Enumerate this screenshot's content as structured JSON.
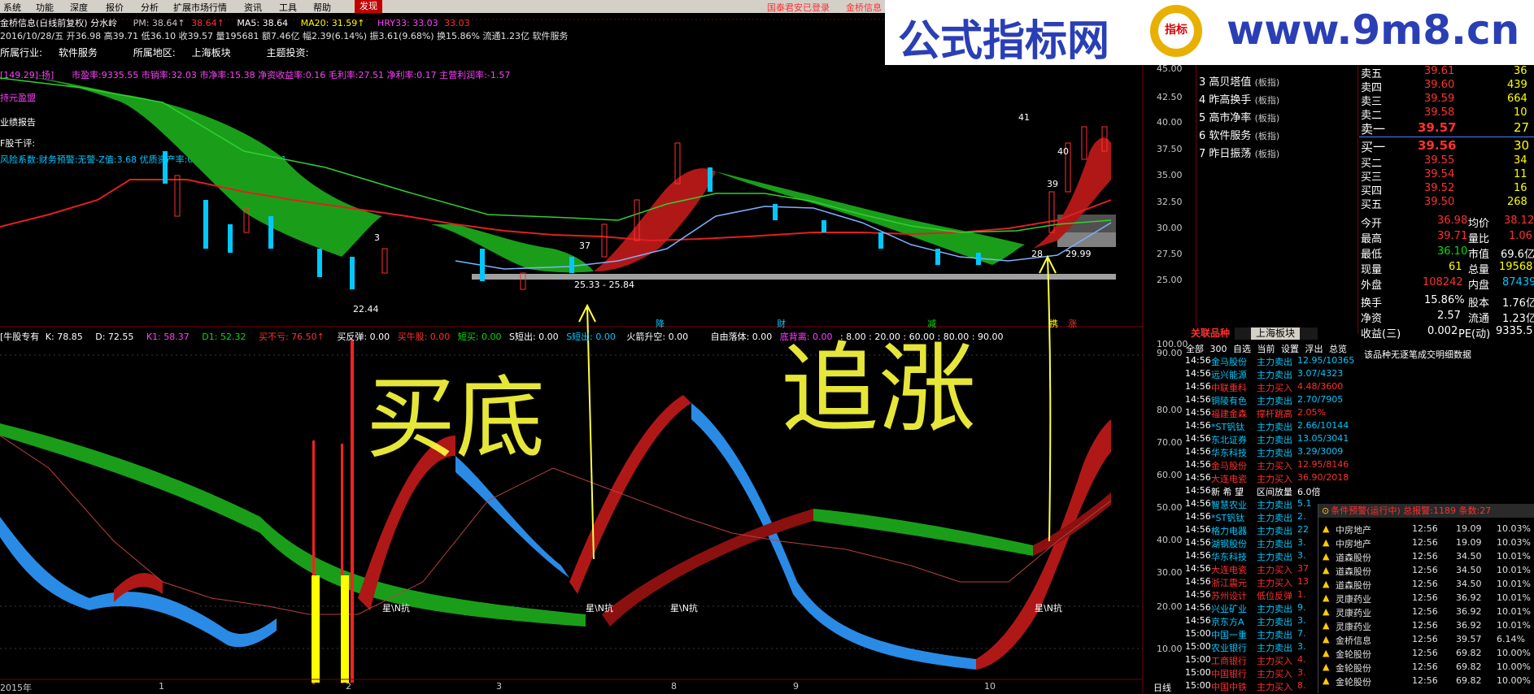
{
  "menu": {
    "items": [
      "系统",
      "功能",
      "深度",
      "报价",
      "分析",
      "扩展市场行情",
      "资讯",
      "工具",
      "帮助",
      "发现"
    ],
    "active_index": 9,
    "right_texts": [
      "国泰君安已登录",
      "金桥信息"
    ]
  },
  "header": {
    "title": "金桥信息(日线前复权) 分水岭",
    "pm": "PM: 38.64↑",
    "pm_val": "38.64↑",
    "ma5": "MA5: 38.64",
    "ma20": "MA20: 31.59↑",
    "hry33": "HRY33: 33.03",
    "hry33_val": "33.03",
    "quote_line": "2016/10/28/五 开36.98 高39.71 低36.10 收39.57 量195681 额7.46亿 幅2.39(6.14%) 振3.61(9.68%) 换15.86% 流通1.23亿 软件服务",
    "industry_label": "所属行业:",
    "industry": "软件服务",
    "region_label": "所属地区:",
    "region": "上海板块",
    "theme_label": "主题投资:",
    "fin_line": "市盈率:9335.55   市销率:32.03   市净率:15.38   净资收益率:0.16   毛利率:27.51   净利率:0.17   主营利润率:-1.57",
    "fin_prefix": "[149.29]-扬]",
    "labels": [
      "持元盈盟",
      "业绩报告",
      "F股千评:"
    ],
    "risk_line": "风险系数:财务预警:无警-Z值:3.68 优质资产率:0.34 现金负债比:-0.411"
  },
  "price_axis": [
    "45.00",
    "42.50",
    "40.00",
    "37.50",
    "35.00",
    "32.50",
    "30.00",
    "27.50",
    "25.00"
  ],
  "price_annotations": [
    "41",
    "40",
    "39",
    "37",
    "28",
    "29.99",
    "25.33 - 25.84",
    "22.44",
    "3"
  ],
  "event_labels": [
    "降",
    "财",
    "减",
    "携",
    "涨"
  ],
  "indicator_header": {
    "name": "[牛股专有",
    "k": "K: 78.85",
    "d": "D: 72.55",
    "k1": "K1: 58.37",
    "d1": "D1: 52.32",
    "buy_no": "买不亏: 76.50↑",
    "rebound": "买反弹: 0.00",
    "bull": "买牛股: 0.00",
    "short_buy": "短买: 0.00",
    "s_short": "S短出: 0.00",
    "s_line": "S短出: 0.00",
    "rocket": "火箭升空: 0.00",
    "freefall": "自由落体: 0.00",
    "bottom": "底背离: 0.00",
    "levels": ": 8.00 : 20.00 : 60.00 : 80.00 : 90.00"
  },
  "indicator_axis": [
    "100.00",
    "90.00",
    "80.00",
    "70.00",
    "60.00",
    "50.00",
    "40.00",
    "30.00",
    "20.00",
    "10.00"
  ],
  "indicator_marks": [
    "星\\N抗",
    "星\\N抗",
    "星\\N抗",
    "星\\N抗"
  ],
  "handwriting": [
    "买底",
    "追涨"
  ],
  "x_axis": [
    "2015年",
    "1",
    "2",
    "3",
    "8",
    "9",
    "10",
    "日线"
  ],
  "rank_list": [
    {
      "n": "3",
      "name": "高贝塔值",
      "tag": "(板指)"
    },
    {
      "n": "4",
      "name": "昨高换手",
      "tag": "(板指)"
    },
    {
      "n": "5",
      "name": "高市净率",
      "tag": "(板指)"
    },
    {
      "n": "6",
      "name": "软件服务",
      "tag": "(板指)"
    },
    {
      "n": "7",
      "name": "昨日振荡",
      "tag": "(板指)"
    }
  ],
  "order_book": {
    "asks": [
      {
        "label": "卖五",
        "price": "39.61",
        "vol": "36"
      },
      {
        "label": "卖四",
        "price": "39.60",
        "vol": "439"
      },
      {
        "label": "卖三",
        "price": "39.59",
        "vol": "664"
      },
      {
        "label": "卖二",
        "price": "39.58",
        "vol": "10"
      },
      {
        "label": "卖一",
        "price": "39.57",
        "vol": "27"
      }
    ],
    "bids": [
      {
        "label": "买一",
        "price": "39.56",
        "vol": "30"
      },
      {
        "label": "买二",
        "price": "39.55",
        "vol": "34"
      },
      {
        "label": "买三",
        "price": "39.54",
        "vol": "11"
      },
      {
        "label": "买四",
        "price": "39.52",
        "vol": "16"
      },
      {
        "label": "买五",
        "price": "39.50",
        "vol": "268"
      }
    ]
  },
  "stats": [
    {
      "l1": "今开",
      "v1": "36.98",
      "l2": "均价",
      "v2": "38.12"
    },
    {
      "l1": "最高",
      "v1": "39.71",
      "l2": "量比",
      "v2": "1.06"
    },
    {
      "l1": "最低",
      "v1": "36.10",
      "l2": "市值",
      "v2": "69.6亿"
    },
    {
      "l1": "现量",
      "v1": "61",
      "l2": "总量",
      "v2": "195681"
    },
    {
      "l1": "外盘",
      "v1": "108242",
      "l2": "内盘",
      "v2": "87439"
    },
    {
      "l1": "换手",
      "v1": "15.86%",
      "l2": "股本",
      "v2": "1.76亿"
    },
    {
      "l1": "净资",
      "v1": "2.57",
      "l2": "流通",
      "v2": "1.23亿"
    },
    {
      "l1": "收益(三)",
      "v1": "0.002",
      "l2": "PE(动)",
      "v2": "9335.5"
    }
  ],
  "tabs": [
    "关联品种",
    "上海板块"
  ],
  "sub_tabs": [
    "全部",
    "300",
    "自选",
    "当前",
    "设置",
    "浮出",
    "总览"
  ],
  "no_data_text": "该品种无逐笔成交明细数据",
  "ticker": [
    {
      "t": "14:56",
      "name": "金马股份",
      "act": "主力卖出",
      "v": "12.95/10365",
      "c": "#00c8ff"
    },
    {
      "t": "14:56",
      "name": "远兴能源",
      "act": "主力卖出",
      "v": "3.07/4323",
      "c": "#00c8ff"
    },
    {
      "t": "14:56",
      "name": "中联重科",
      "act": "主力买入",
      "v": "4.48/3600",
      "c": "#ff3030"
    },
    {
      "t": "14:56",
      "name": "铜陵有色",
      "act": "主力卖出",
      "v": "2.70/7905",
      "c": "#00c8ff"
    },
    {
      "t": "14:56",
      "name": "福建金森",
      "act": "撑杆跳高",
      "v": "2.05%",
      "c": "#ff3030"
    },
    {
      "t": "14:56",
      "name": "*ST钒钛",
      "act": "主力卖出",
      "v": "2.66/10144",
      "c": "#00c8ff"
    },
    {
      "t": "14:56",
      "name": "东北证券",
      "act": "主力卖出",
      "v": "13.05/3041",
      "c": "#00c8ff"
    },
    {
      "t": "14:56",
      "name": "华东科技",
      "act": "主力卖出",
      "v": "3.29/3009",
      "c": "#00c8ff"
    },
    {
      "t": "14:56",
      "name": "金马股份",
      "act": "主力买入",
      "v": "12.95/8146",
      "c": "#ff3030"
    },
    {
      "t": "14:56",
      "name": "大连电瓷",
      "act": "主力买入",
      "v": "36.90/2018",
      "c": "#ff3030"
    },
    {
      "t": "14:56",
      "name": "新 希 望",
      "act": "区间放量",
      "v": "6.0倍",
      "c": "#ffffff"
    },
    {
      "t": "14:56",
      "name": "智慧农业",
      "act": "主力卖出",
      "v": "5.1",
      "c": "#00c8ff"
    },
    {
      "t": "14:56",
      "name": "*ST钒钛",
      "act": "主力卖出",
      "v": "2.",
      "c": "#00c8ff"
    },
    {
      "t": "14:56",
      "name": "格力电器",
      "act": "主力卖出",
      "v": "22",
      "c": "#00c8ff"
    },
    {
      "t": "14:56",
      "name": "湖钢股份",
      "act": "主力卖出",
      "v": "3.",
      "c": "#00c8ff"
    },
    {
      "t": "14:56",
      "name": "华东科技",
      "act": "主力卖出",
      "v": "3.",
      "c": "#00c8ff"
    },
    {
      "t": "14:56",
      "name": "大连电瓷",
      "act": "主力买入",
      "v": "37",
      "c": "#ff3030"
    },
    {
      "t": "14:56",
      "name": "浙江震元",
      "act": "主力买入",
      "v": "13",
      "c": "#ff3030"
    },
    {
      "t": "14:56",
      "name": "苏州设计",
      "act": "低位反弹",
      "v": "1.",
      "c": "#ff3030"
    },
    {
      "t": "14:56",
      "name": "兴业矿业",
      "act": "主力卖出",
      "v": "9.",
      "c": "#00c8ff"
    },
    {
      "t": "14:56",
      "name": "京东方A",
      "act": "主力卖出",
      "v": "3.",
      "c": "#00c8ff"
    },
    {
      "t": "15:00",
      "name": "中国一重",
      "act": "主力卖出",
      "v": "7.",
      "c": "#00c8ff"
    },
    {
      "t": "15:00",
      "name": "农业银行",
      "act": "主力卖出",
      "v": "3.",
      "c": "#00c8ff"
    },
    {
      "t": "15:00",
      "name": "工商银行",
      "act": "主力买入",
      "v": "4.",
      "c": "#ff3030"
    },
    {
      "t": "15:00",
      "name": "中国银行",
      "act": "主力买入",
      "v": "3.",
      "c": "#ff3030"
    },
    {
      "t": "15:00",
      "name": "中国中铁",
      "act": "主力买入",
      "v": "8.",
      "c": "#ff3030"
    }
  ],
  "cond_header": "条件预警(运行中) 总报警:1189 条数:27",
  "cond_rows": [
    {
      "name": "中房地产",
      "t": "12:56",
      "p": "19.09",
      "pct": "10.03%"
    },
    {
      "name": "中房地产",
      "t": "12:56",
      "p": "19.09",
      "pct": "10.03%"
    },
    {
      "name": "道森股份",
      "t": "12:56",
      "p": "34.50",
      "pct": "10.01%"
    },
    {
      "name": "道森股份",
      "t": "12:56",
      "p": "34.50",
      "pct": "10.01%"
    },
    {
      "name": "道森股份",
      "t": "12:56",
      "p": "34.50",
      "pct": "10.01%"
    },
    {
      "name": "灵康药业",
      "t": "12:56",
      "p": "36.92",
      "pct": "10.01%"
    },
    {
      "name": "灵康药业",
      "t": "12:56",
      "p": "36.92",
      "pct": "10.01%"
    },
    {
      "name": "灵康药业",
      "t": "12:56",
      "p": "36.92",
      "pct": "10.01%"
    },
    {
      "name": "金桥信息",
      "t": "12:56",
      "p": "39.57",
      "pct": "6.14%"
    },
    {
      "name": "金轮股份",
      "t": "12:56",
      "p": "69.82",
      "pct": "10.00%"
    },
    {
      "name": "金轮股份",
      "t": "12:56",
      "p": "69.82",
      "pct": "10.00%"
    },
    {
      "name": "金轮股份",
      "t": "12:56",
      "p": "69.82",
      "pct": "10.00%"
    }
  ],
  "watermark": {
    "text": "公式指标网",
    "url": "www.9m8.cn",
    "badge": "指标"
  },
  "colors": {
    "up": "#ff3030",
    "down": "#00c8ff",
    "green_band": "#1a9e1a",
    "red_band": "#b01818",
    "blue_band": "#2a8be6",
    "axis": "#7a0000"
  }
}
